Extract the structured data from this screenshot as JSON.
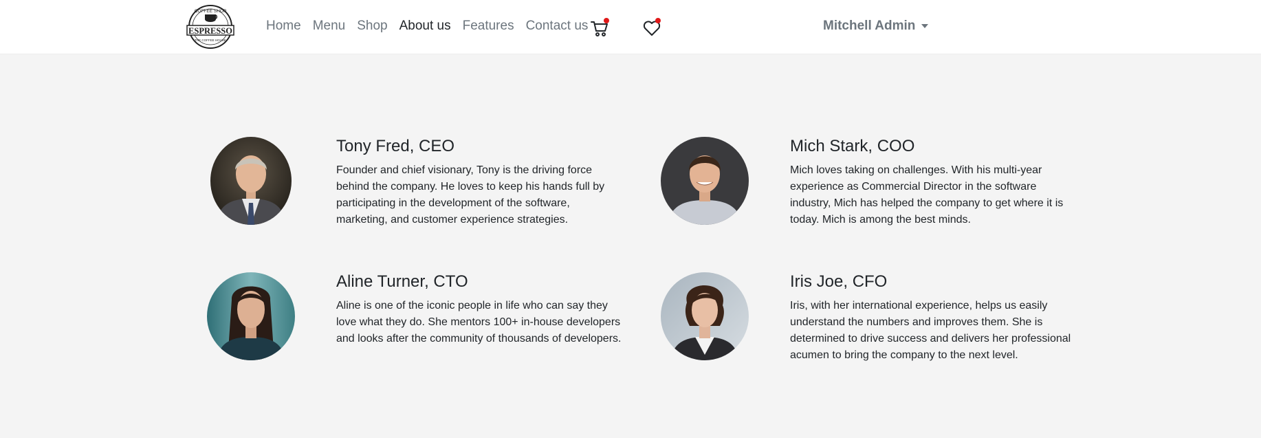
{
  "brand": {
    "logo_top": "COFFEE SHOP",
    "logo_main": "ESPRESSO",
    "logo_bottom": "THE COFFEE HOUSE"
  },
  "nav": {
    "links": [
      "Home",
      "Menu",
      "Shop",
      "About us",
      "Features",
      "Contact us"
    ],
    "active": "About us",
    "user": "Mitchell Admin"
  },
  "colors": {
    "badge": "#e01818",
    "background": "#f4f4f4"
  },
  "team": [
    {
      "name": "Tony Fred, CEO",
      "bio": "Founder and chief visionary, Tony is the driving force behind the company. He loves to keep his hands full by participating in the development of the software, marketing, and customer experience strategies."
    },
    {
      "name": "Mich Stark, COO",
      "bio": "Mich loves taking on challenges. With his multi-year experience as Commercial Director in the software industry, Mich has helped the company to get where it is today. Mich is among the best minds."
    },
    {
      "name": "Aline Turner, CTO",
      "bio": "Aline is one of the iconic people in life who can say they love what they do. She mentors 100+ in-house developers and looks after the community of thousands of developers."
    },
    {
      "name": "Iris Joe, CFO",
      "bio": "Iris, with her international experience, helps us easily understand the numbers and improves them. She is determined to drive success and delivers her professional acumen to bring the company to the next level."
    }
  ]
}
